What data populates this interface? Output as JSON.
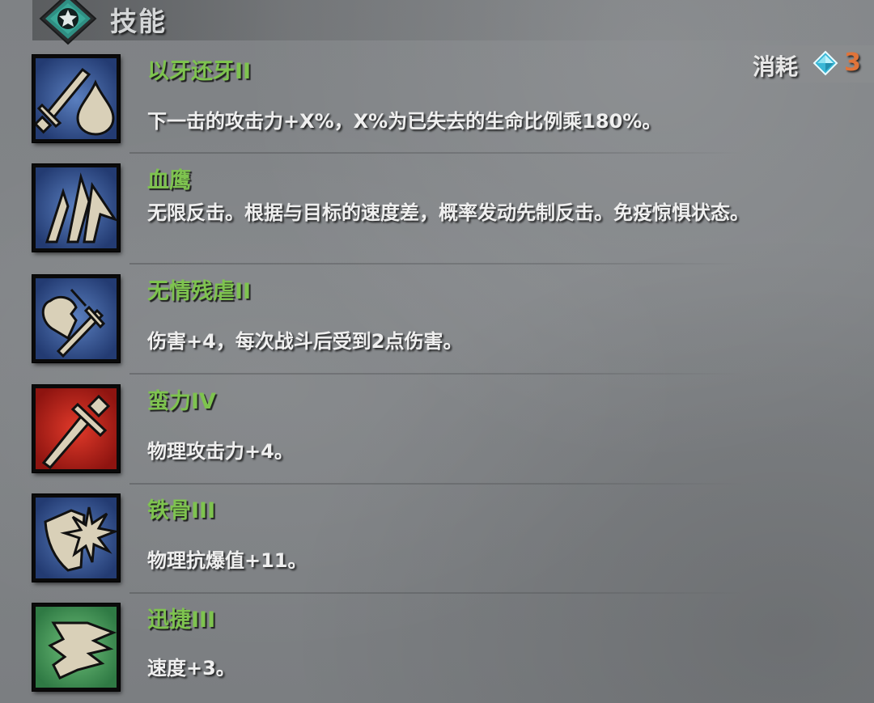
{
  "header": {
    "title": "技能",
    "badge_icon": "star-badge-icon"
  },
  "cost": {
    "label": "消耗",
    "icon": "gem-icon",
    "value": "3"
  },
  "colors": {
    "skill_name": "#7ec34f",
    "cost_value": "#e0743a",
    "gem": "#6fd3e8"
  },
  "skills": [
    {
      "name": "以牙还牙II",
      "desc": "下一击的攻击力+X%，X%为已失去的生命比例乘180%。",
      "icon": "sword-and-drop-icon",
      "icon_bg": "blue"
    },
    {
      "name": "血鹰",
      "desc": "无限反击。根据与目标的速度差，概率发动先制反击。免疫惊惧状态。",
      "icon": "claw-icon",
      "icon_bg": "blue"
    },
    {
      "name": "无情残虐II",
      "desc": "伤害+4，每次战斗后受到2点伤害。",
      "icon": "broken-heart-sword-icon",
      "icon_bg": "blue"
    },
    {
      "name": "蛮力IV",
      "desc": "物理攻击力+4。",
      "icon": "sword-icon",
      "icon_bg": "red"
    },
    {
      "name": "铁骨III",
      "desc": "物理抗爆值+11。",
      "icon": "shield-burst-icon",
      "icon_bg": "blue"
    },
    {
      "name": "迅捷III",
      "desc": "速度+3。",
      "icon": "winged-foot-icon",
      "icon_bg": "green"
    }
  ]
}
